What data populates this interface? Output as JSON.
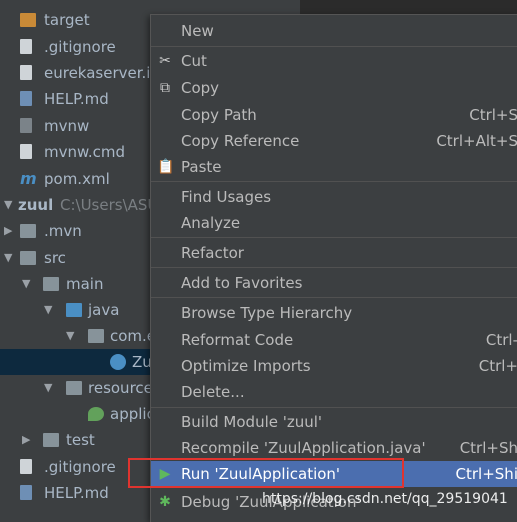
{
  "tree": {
    "items": [
      {
        "label": "target",
        "icon": "folder-orange-icon"
      },
      {
        "label": ".gitignore",
        "icon": "gitignore-file-icon"
      },
      {
        "label": "eurekaserver.in",
        "icon": "iml-file-icon"
      },
      {
        "label": "HELP.md",
        "icon": "markdown-file-icon"
      },
      {
        "label": "mvnw",
        "icon": "script-file-icon"
      },
      {
        "label": "mvnw.cmd",
        "icon": "text-file-icon"
      },
      {
        "label": "pom.xml",
        "icon": "maven-file-icon"
      },
      {
        "label": "zuul",
        "path": "C:\\Users\\ASU",
        "icon": "module-folder-icon"
      },
      {
        "label": ".mvn",
        "icon": "folder-icon"
      },
      {
        "label": "src",
        "icon": "folder-icon"
      },
      {
        "label": "main",
        "icon": "folder-icon"
      },
      {
        "label": "java",
        "icon": "source-folder-icon"
      },
      {
        "label": "com.e",
        "icon": "package-icon"
      },
      {
        "label": "Zu",
        "icon": "spring-class-icon"
      },
      {
        "label": "resource",
        "icon": "resources-folder-icon"
      },
      {
        "label": "applic",
        "icon": "spring-config-icon"
      },
      {
        "label": "test",
        "icon": "folder-icon"
      },
      {
        "label": ".gitignore",
        "icon": "gitignore-file-icon"
      },
      {
        "label": "HELP.md",
        "icon": "markdown-file-icon"
      }
    ]
  },
  "menu": {
    "items": [
      {
        "label": "New",
        "shortcut": "",
        "icon": ""
      },
      {
        "label": "Cut",
        "shortcut": "",
        "icon": "scissors-icon"
      },
      {
        "label": "Copy",
        "shortcut": "",
        "icon": "copy-icon"
      },
      {
        "label": "Copy Path",
        "shortcut": "Ctrl+S",
        "icon": ""
      },
      {
        "label": "Copy Reference",
        "shortcut": "Ctrl+Alt+S",
        "icon": ""
      },
      {
        "label": "Paste",
        "shortcut": "",
        "icon": "clipboard-icon"
      },
      {
        "label": "Find Usages",
        "shortcut": "",
        "icon": ""
      },
      {
        "label": "Analyze",
        "shortcut": "",
        "icon": ""
      },
      {
        "label": "Refactor",
        "shortcut": "",
        "icon": ""
      },
      {
        "label": "Add to Favorites",
        "shortcut": "",
        "icon": ""
      },
      {
        "label": "Browse Type Hierarchy",
        "shortcut": "",
        "icon": ""
      },
      {
        "label": "Reformat Code",
        "shortcut": "Ctrl-",
        "icon": ""
      },
      {
        "label": "Optimize Imports",
        "shortcut": "Ctrl+",
        "icon": ""
      },
      {
        "label": "Delete...",
        "shortcut": "",
        "icon": ""
      },
      {
        "label": "Build Module 'zuul'",
        "shortcut": "",
        "icon": ""
      },
      {
        "label": "Recompile 'ZuulApplication.java'",
        "shortcut": "Ctrl+Sh",
        "icon": ""
      },
      {
        "label": "Run 'ZuulApplication'",
        "shortcut": "Ctrl+Shi",
        "icon": "run-icon",
        "highlighted": true
      },
      {
        "label": "Debug 'ZuulApplication'",
        "shortcut": "",
        "icon": "debug-icon"
      }
    ]
  },
  "watermark": "https://blog.csdn.net/qq_29519041"
}
